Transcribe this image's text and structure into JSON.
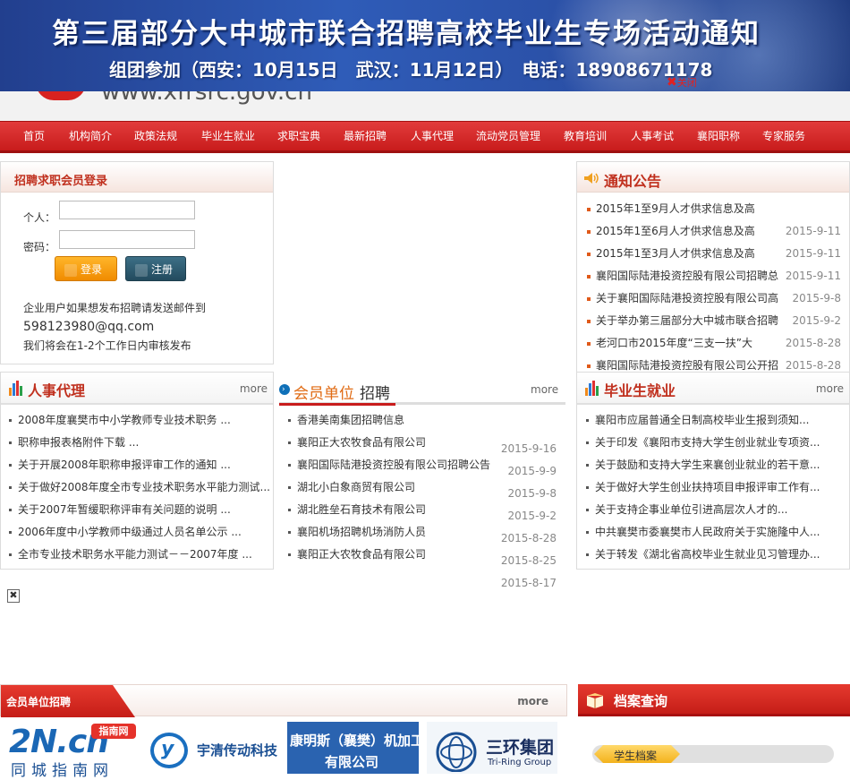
{
  "banner": {
    "title": "第三届部分大中城市联合招聘高校毕业生专场活动通知",
    "subtitle": "组团参加（西安：10月15日　武汉：11月12日）　电话：18908671178",
    "close_label": "关闭"
  },
  "logo": {
    "url": "www.xfrsrc.gov.cn"
  },
  "nav": {
    "items": [
      "首页",
      "机构简介",
      "政策法规",
      "毕业生就业",
      "求职宝典",
      "最新招聘",
      "人事代理",
      "流动党员管理",
      "教育培训",
      "人事考试",
      "襄阳职称",
      "专家服务"
    ]
  },
  "login": {
    "title": "招聘求职会员登录",
    "user_label": "个人：",
    "pass_label": "密码：",
    "login_btn": "登录",
    "register_btn": "注册",
    "note1": "企业用户如果想发布招聘请发送邮件到",
    "email": "598123980@qq.com",
    "note2": "我们将会在1-2个工作日内审核发布"
  },
  "notice": {
    "title": "通知公告",
    "items": [
      {
        "text": "2015年1至9月人才供求信息及高",
        "date": ""
      },
      {
        "text": "2015年1至6月人才供求信息及高",
        "date": "2015-9-11"
      },
      {
        "text": "2015年1至3月人才供求信息及高",
        "date": "2015-9-11"
      },
      {
        "text": "襄阳国际陆港投资控股有限公司招聘总",
        "date": "2015-9-11"
      },
      {
        "text": "关于襄阳国际陆港投资控股有限公司高",
        "date": "2015-9-8"
      },
      {
        "text": "关于举办第三届部分大中城市联合招聘",
        "date": "2015-9-2"
      },
      {
        "text": "老河口市2015年度“三支一扶”大",
        "date": "2015-8-28"
      },
      {
        "text": "襄阳国际陆港投资控股有限公司公开招",
        "date": "2015-8-28"
      }
    ]
  },
  "hr_agency": {
    "title": "人事代理",
    "more": "more",
    "items": [
      "2008年度襄樊市中小学教师专业技术职务 ...",
      "职称申报表格附件下载 ...",
      "关于开展2008年职称申报评审工作的通知 ...",
      "关于做好2008年度全市专业技术职务水平能力测试...",
      "关于2007年暂缓职称评审有关问题的说明 ...",
      "2006年度中小学教师中级通过人员名单公示 ...",
      "全市专业技术职务水平能力测试－－2007年度 ..."
    ]
  },
  "member_recruit": {
    "title_a": "会员单位",
    "title_b": "招聘",
    "more": "more",
    "items": [
      {
        "text": "香港美南集团招聘信息",
        "date": ""
      },
      {
        "text": "襄阳正大农牧食品有限公司",
        "date": "2015-9-16"
      },
      {
        "text": "襄阳国际陆港投资控股有限公司招聘公告",
        "date": "2015-9-9"
      },
      {
        "text": "湖北小白象商贸有限公司",
        "date": "2015-9-8"
      },
      {
        "text": "湖北胜垒石育技术有限公司",
        "date": "2015-9-2"
      },
      {
        "text": "襄阳机场招聘机场消防人员",
        "date": "2015-8-28"
      },
      {
        "text": "襄阳正大农牧食品有限公司",
        "date": "2015-8-25"
      },
      {
        "text": "",
        "date": "2015-8-17"
      }
    ]
  },
  "graduate": {
    "title": "毕业生就业",
    "more": "more",
    "items": [
      "襄阳市应届普通全日制高校毕业生报到须知...",
      "关于印发《襄阳市支持大学生创业就业专项资...",
      "关于鼓励和支持大学生来襄创业就业的若干意...",
      "关于做好大学生创业扶持项目申报评审工作有...",
      "关于支持企事业单位引进高层次人才的...",
      "中共襄樊市委襄樊市人民政府关于实施隆中人...",
      "关于转发《湖北省高校毕业生就业见习管理办..."
    ]
  },
  "bottom": {
    "member_title": "会员单位招聘",
    "more": "more",
    "archive_title": "档案查询",
    "student_archive": "学生档案"
  },
  "logos": {
    "zn_main": "2N.cn",
    "zn_tag": "指南网",
    "zn_sub": "同城指南网",
    "yuqing": "宇清传动科技",
    "kangmingsi_1": "康明斯（襄樊）机加工",
    "kangmingsi_2": "有限公司",
    "sanhuan": "三环集团",
    "sanhuan_en": "Tri-Ring Group"
  },
  "colors": {
    "accent": "#c81c1c",
    "title": "#c0301e",
    "orange": "#e06a12"
  }
}
